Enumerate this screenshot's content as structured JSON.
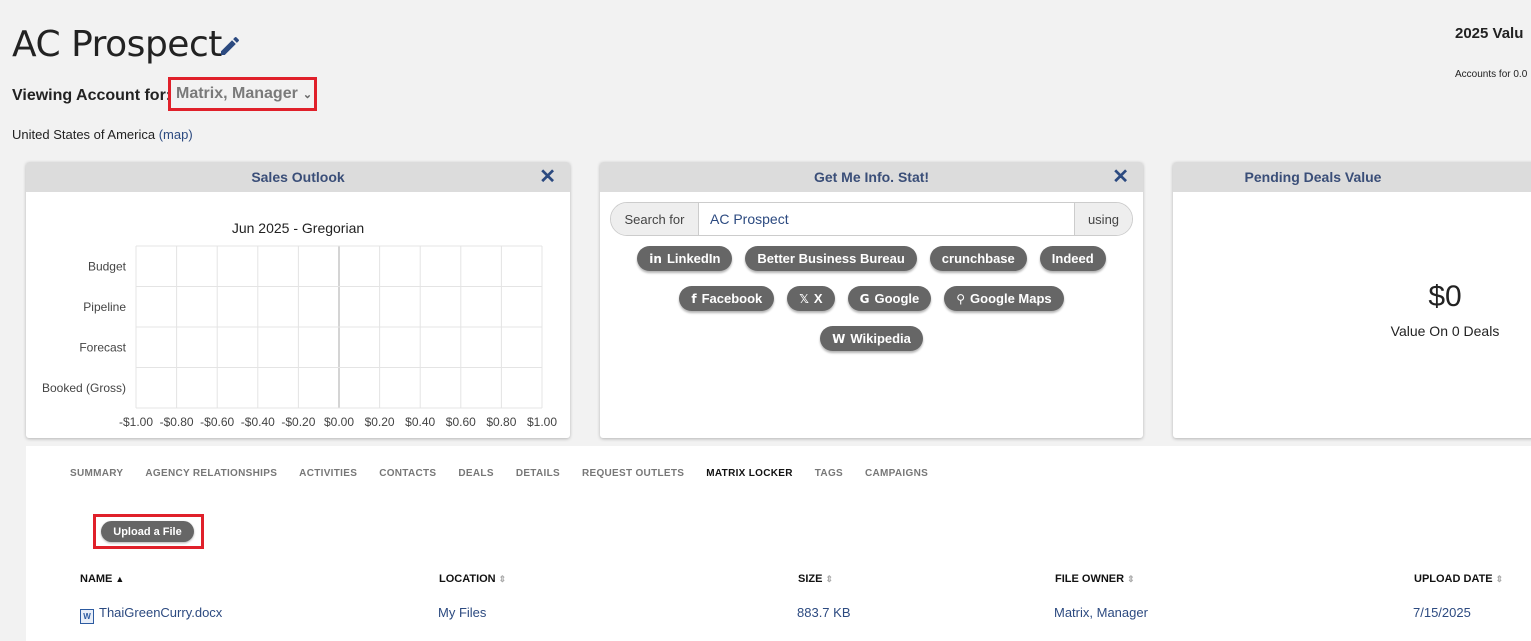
{
  "header": {
    "title": "AC Prospect",
    "summary_title": "2025 Valu",
    "summary_sub": "Accounts for 0.0",
    "viewing_label": "Viewing Account for:",
    "viewing_value": "Matrix, Manager",
    "country": "United States of America",
    "map_link": "(map)"
  },
  "sales_outlook": {
    "title": "Sales Outlook",
    "close": "✕"
  },
  "chart_data": {
    "type": "bar",
    "title": "Jun 2025 - Gregorian",
    "categories": [
      "Budget",
      "Pipeline",
      "Forecast",
      "Booked (Gross)"
    ],
    "values": [
      0,
      0,
      0,
      0
    ],
    "xlim": [
      -1.0,
      1.0
    ],
    "x_ticks": [
      "-$1.00",
      "-$0.80",
      "-$0.60",
      "-$0.40",
      "-$0.20",
      "$0.00",
      "$0.20",
      "$0.40",
      "$0.60",
      "$0.80",
      "$1.00"
    ],
    "orientation": "horizontal",
    "grid": true
  },
  "info_panel": {
    "title": "Get Me Info. Stat!",
    "close": "✕",
    "search_prefix": "Search for",
    "search_value": "AC Prospect",
    "search_suffix": "using",
    "rows": [
      [
        {
          "icon": "in",
          "icon_name": "linkedin-icon",
          "label": "LinkedIn"
        },
        {
          "icon": "",
          "icon_name": "",
          "label": "Better Business Bureau"
        },
        {
          "icon": "",
          "icon_name": "",
          "label": "crunchbase"
        },
        {
          "icon": "",
          "icon_name": "",
          "label": "Indeed"
        }
      ],
      [
        {
          "icon": "f",
          "icon_name": "facebook-icon",
          "label": "Facebook"
        },
        {
          "icon": "𝕏",
          "icon_name": "x-icon",
          "label": "X"
        },
        {
          "icon": "G",
          "icon_name": "google-icon",
          "label": "Google"
        },
        {
          "icon": "⚲",
          "icon_name": "map-pin-icon",
          "label": "Google Maps"
        }
      ],
      [
        {
          "icon": "W",
          "icon_name": "wikipedia-icon",
          "label": "Wikipedia"
        }
      ]
    ]
  },
  "pending_deals": {
    "title": "Pending Deals Value",
    "value": "$0",
    "sub": "Value On 0 Deals"
  },
  "tabs": [
    "SUMMARY",
    "AGENCY RELATIONSHIPS",
    "ACTIVITIES",
    "CONTACTS",
    "DEALS",
    "DETAILS",
    "REQUEST OUTLETS",
    "MATRIX LOCKER",
    "TAGS",
    "CAMPAIGNS"
  ],
  "active_tab": "MATRIX LOCKER",
  "upload_label": "Upload a File",
  "table": {
    "headers": [
      "NAME",
      "LOCATION",
      "SIZE",
      "FILE OWNER",
      "UPLOAD DATE"
    ],
    "rows": [
      [
        "ThaiGreenCurry.docx",
        "My Files",
        "883.7 KB",
        "Matrix, Manager",
        "7/15/2025"
      ]
    ]
  },
  "colors": {
    "accent": "#2c4a80",
    "highlight_frame": "#e0202a",
    "pill": "#666666"
  }
}
